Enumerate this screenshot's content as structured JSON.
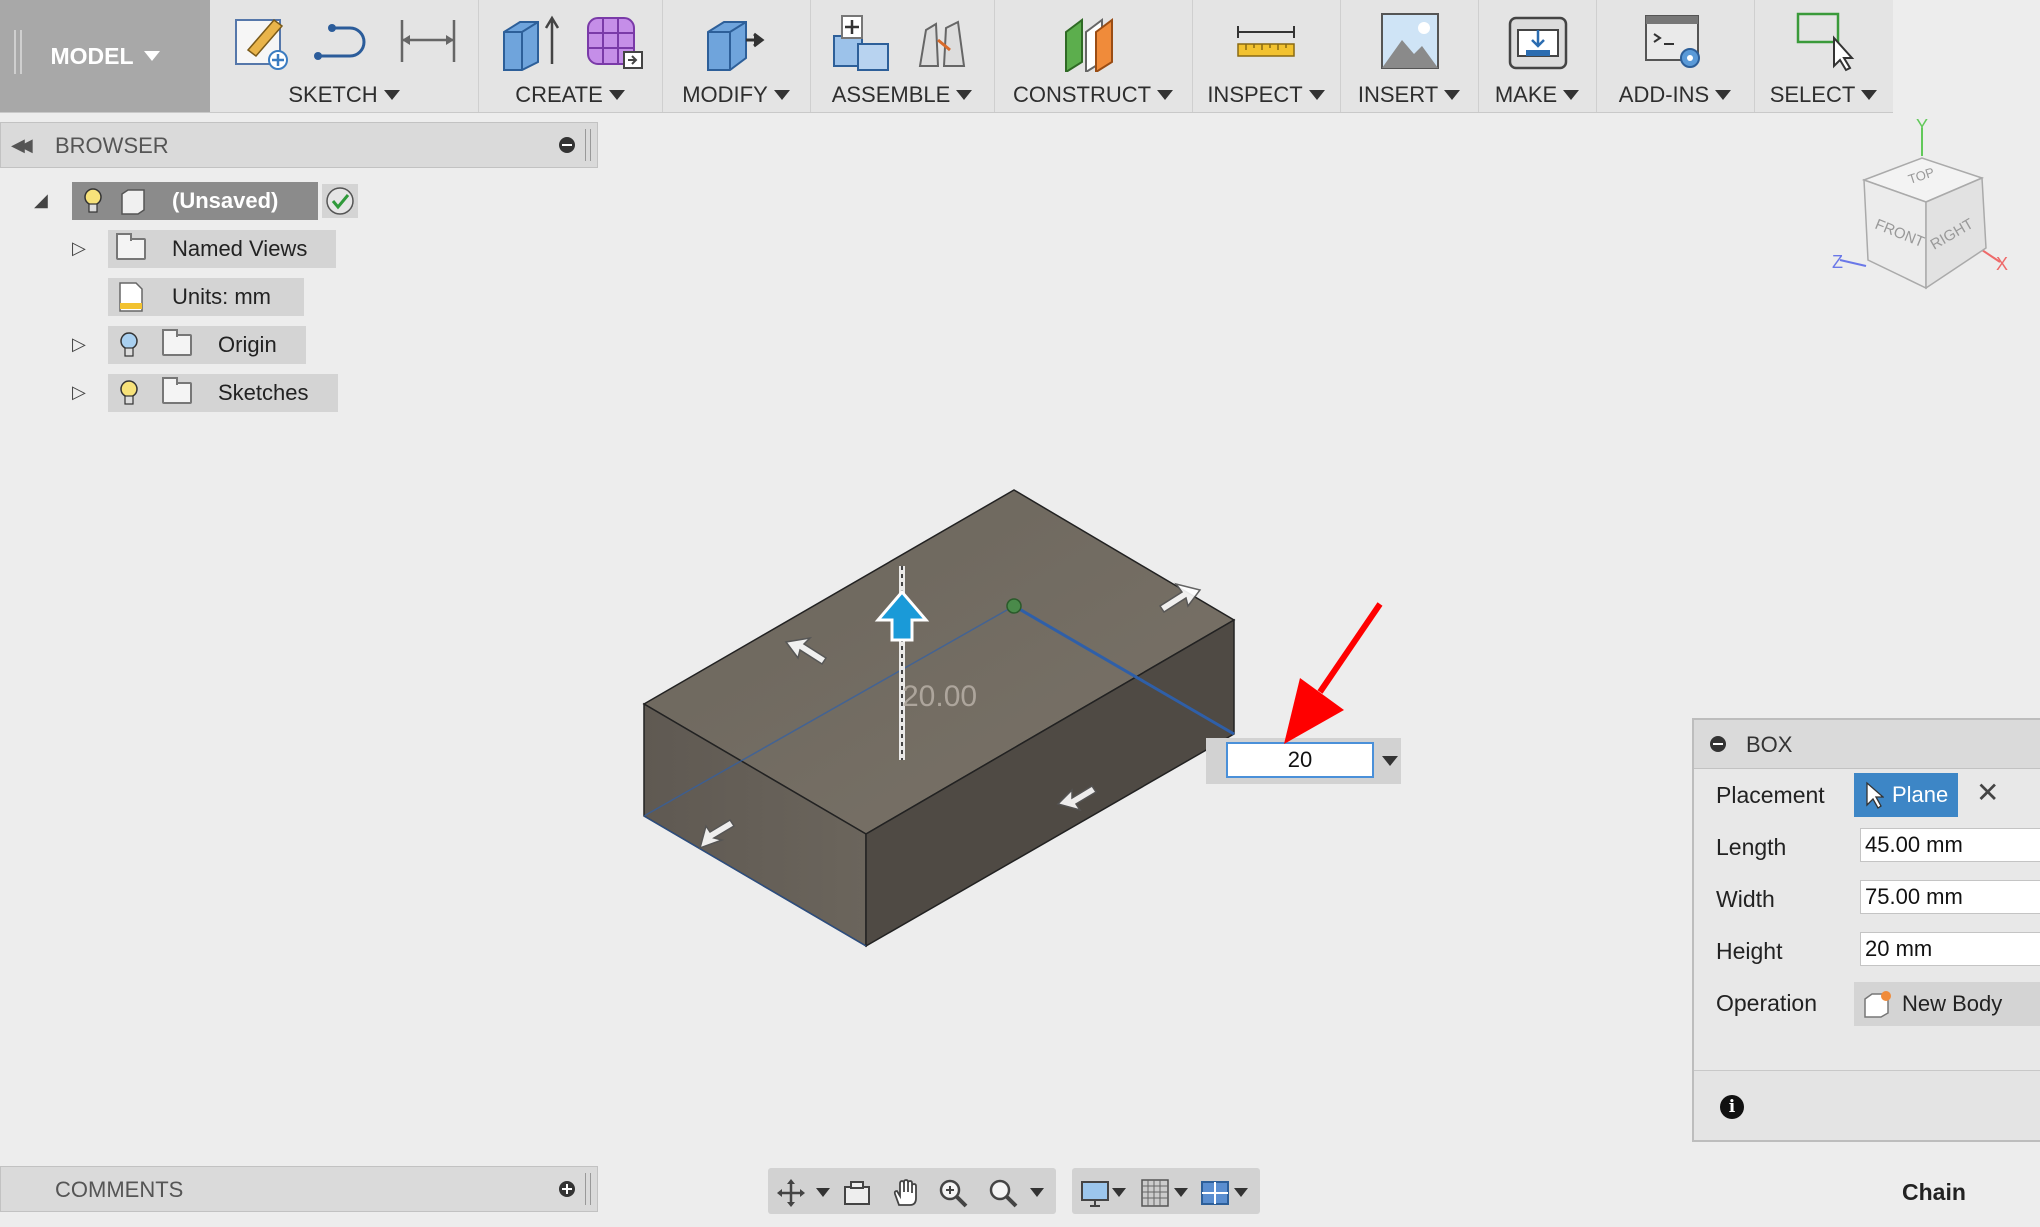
{
  "toolbar": {
    "workspace": "MODEL",
    "groups": [
      {
        "label": "SKETCH"
      },
      {
        "label": "CREATE"
      },
      {
        "label": "MODIFY"
      },
      {
        "label": "ASSEMBLE"
      },
      {
        "label": "CONSTRUCT"
      },
      {
        "label": "INSPECT"
      },
      {
        "label": "INSERT"
      },
      {
        "label": "MAKE"
      },
      {
        "label": "ADD-INS"
      },
      {
        "label": "SELECT"
      }
    ]
  },
  "browser": {
    "title": "BROWSER",
    "root": {
      "label": "(Unsaved)"
    },
    "items": [
      {
        "label": "Named Views"
      },
      {
        "label": "Units: mm"
      },
      {
        "label": "Origin"
      },
      {
        "label": "Sketches"
      }
    ]
  },
  "viewcube": {
    "top": "TOP",
    "front": "FRONT",
    "right": "RIGHT",
    "axis_x": "X",
    "axis_y": "Y",
    "axis_z": "Z"
  },
  "viewport": {
    "height_readout": "20.00",
    "dimension_input": "20"
  },
  "box_dialog": {
    "title": "BOX",
    "placement_label": "Placement",
    "placement_value": "Plane",
    "length_label": "Length",
    "length_value": "45.00 mm",
    "width_label": "Width",
    "width_value": "75.00 mm",
    "height_label": "Height",
    "height_value": "20 mm",
    "operation_label": "Operation",
    "operation_value": "New Body"
  },
  "comments": {
    "title": "COMMENTS"
  },
  "status": {
    "chain": "Chain"
  },
  "colors": {
    "accent": "#3d86c6",
    "annotation_arrow": "#ff0000",
    "box_top": "#716a61",
    "box_side": "#5a544d"
  }
}
